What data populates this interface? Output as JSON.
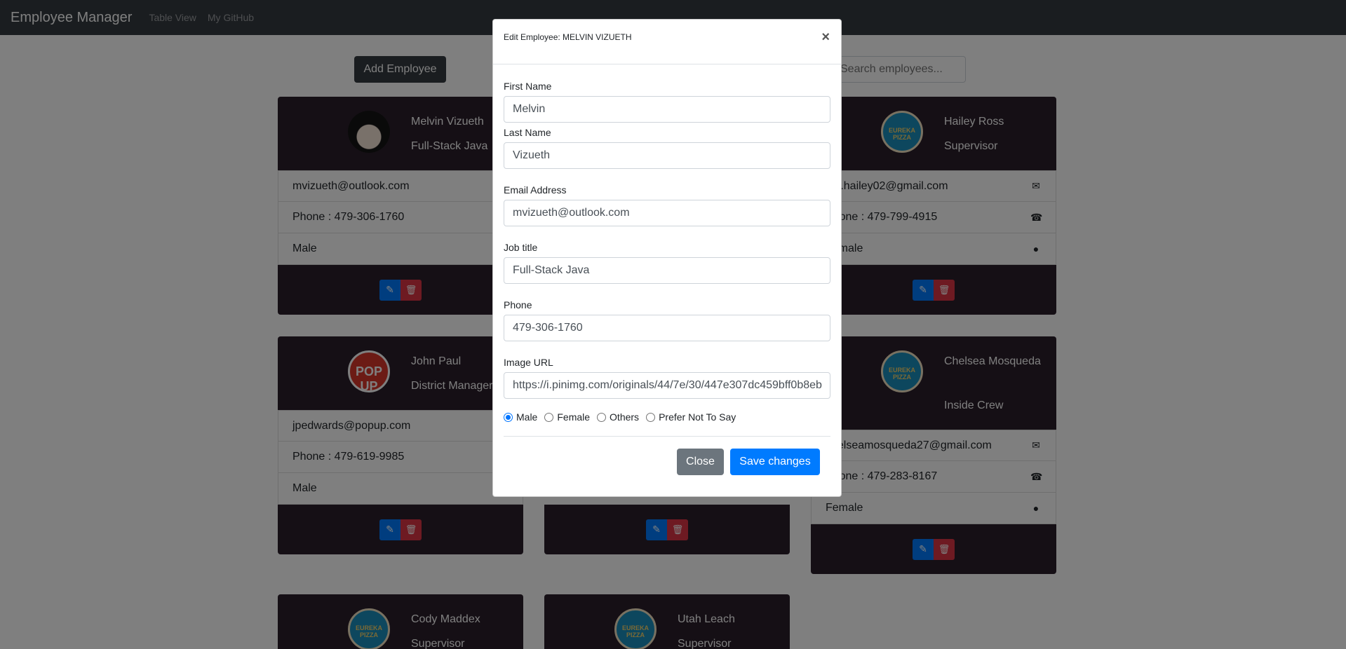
{
  "navbar": {
    "brand": "Employee Manager",
    "links": [
      "Table View",
      "My GitHub"
    ]
  },
  "toolbar": {
    "add_label": "Add Employee",
    "search_placeholder": "Search employees..."
  },
  "employees": [
    {
      "name": "Melvin Vizueth",
      "title": "Full-Stack Java",
      "email": "mvizueth@outlook.com",
      "phone": "Phone : 479-306-1760",
      "gender": "Male",
      "avatar": "anime-avatar"
    },
    {
      "name": "John Paul",
      "title": "District Manager",
      "email": "jpedwards@popup.com",
      "phone": "Phone : 479-619-9985",
      "gender": "Male",
      "avatar": "popup-logo",
      "avatar_text": "POP UP"
    },
    {
      "name": "Hailey Ross",
      "title": "Supervisor",
      "email": "rss.hailey02@gmail.com",
      "phone": "Phone : 479-799-4915",
      "gender": "Female",
      "avatar": "eureka-pizza-logo",
      "avatar_text": "EUREKA PIZZA"
    },
    {
      "name": "Chelsea Mosqueda",
      "title": "Inside Crew",
      "email": "chelseamosqueda27@gmail.com",
      "phone": "Phone : 479-283-8167",
      "gender": "Female",
      "avatar": "eureka-pizza-logo",
      "avatar_text": "EUREKA PIZZA"
    },
    {
      "name": "Cody Maddex",
      "title": "Supervisor",
      "avatar": "eureka-pizza-logo",
      "avatar_text": "EUREKA PIZZA"
    },
    {
      "name": "Utah Leach",
      "title": "Supervisor",
      "avatar": "eureka-pizza-logo",
      "avatar_text": "EUREKA PIZZA"
    }
  ],
  "icons": {
    "email": "envelope-icon",
    "phone": "phone-icon",
    "gender": "user-icon",
    "edit": "edit-icon",
    "delete": "trash-icon"
  },
  "modal": {
    "title": "Edit Employee: MELVIN VIZUETH",
    "close_symbol": "×",
    "fields": {
      "first_name": {
        "label": "First Name",
        "value": "Melvin"
      },
      "last_name": {
        "label": "Last Name",
        "value": "Vizueth"
      },
      "email": {
        "label": "Email Address",
        "value": "mvizueth@outlook.com"
      },
      "job_title": {
        "label": "Job title",
        "value": "Full-Stack Java"
      },
      "phone": {
        "label": "Phone",
        "value": "479-306-1760"
      },
      "image_url": {
        "label": "Image URL",
        "value": "https://i.pinimg.com/originals/44/7e/30/447e307dc459bff0b8eb"
      }
    },
    "gender_options": [
      "Male",
      "Female",
      "Others",
      "Prefer Not To Say"
    ],
    "gender_selected": "Male",
    "close_label": "Close",
    "save_label": "Save changes"
  },
  "colors": {
    "navbar": "#343a40",
    "card": "#2b1f2b",
    "primary": "#007bff",
    "danger": "#dc3545",
    "secondary": "#6c757d"
  }
}
